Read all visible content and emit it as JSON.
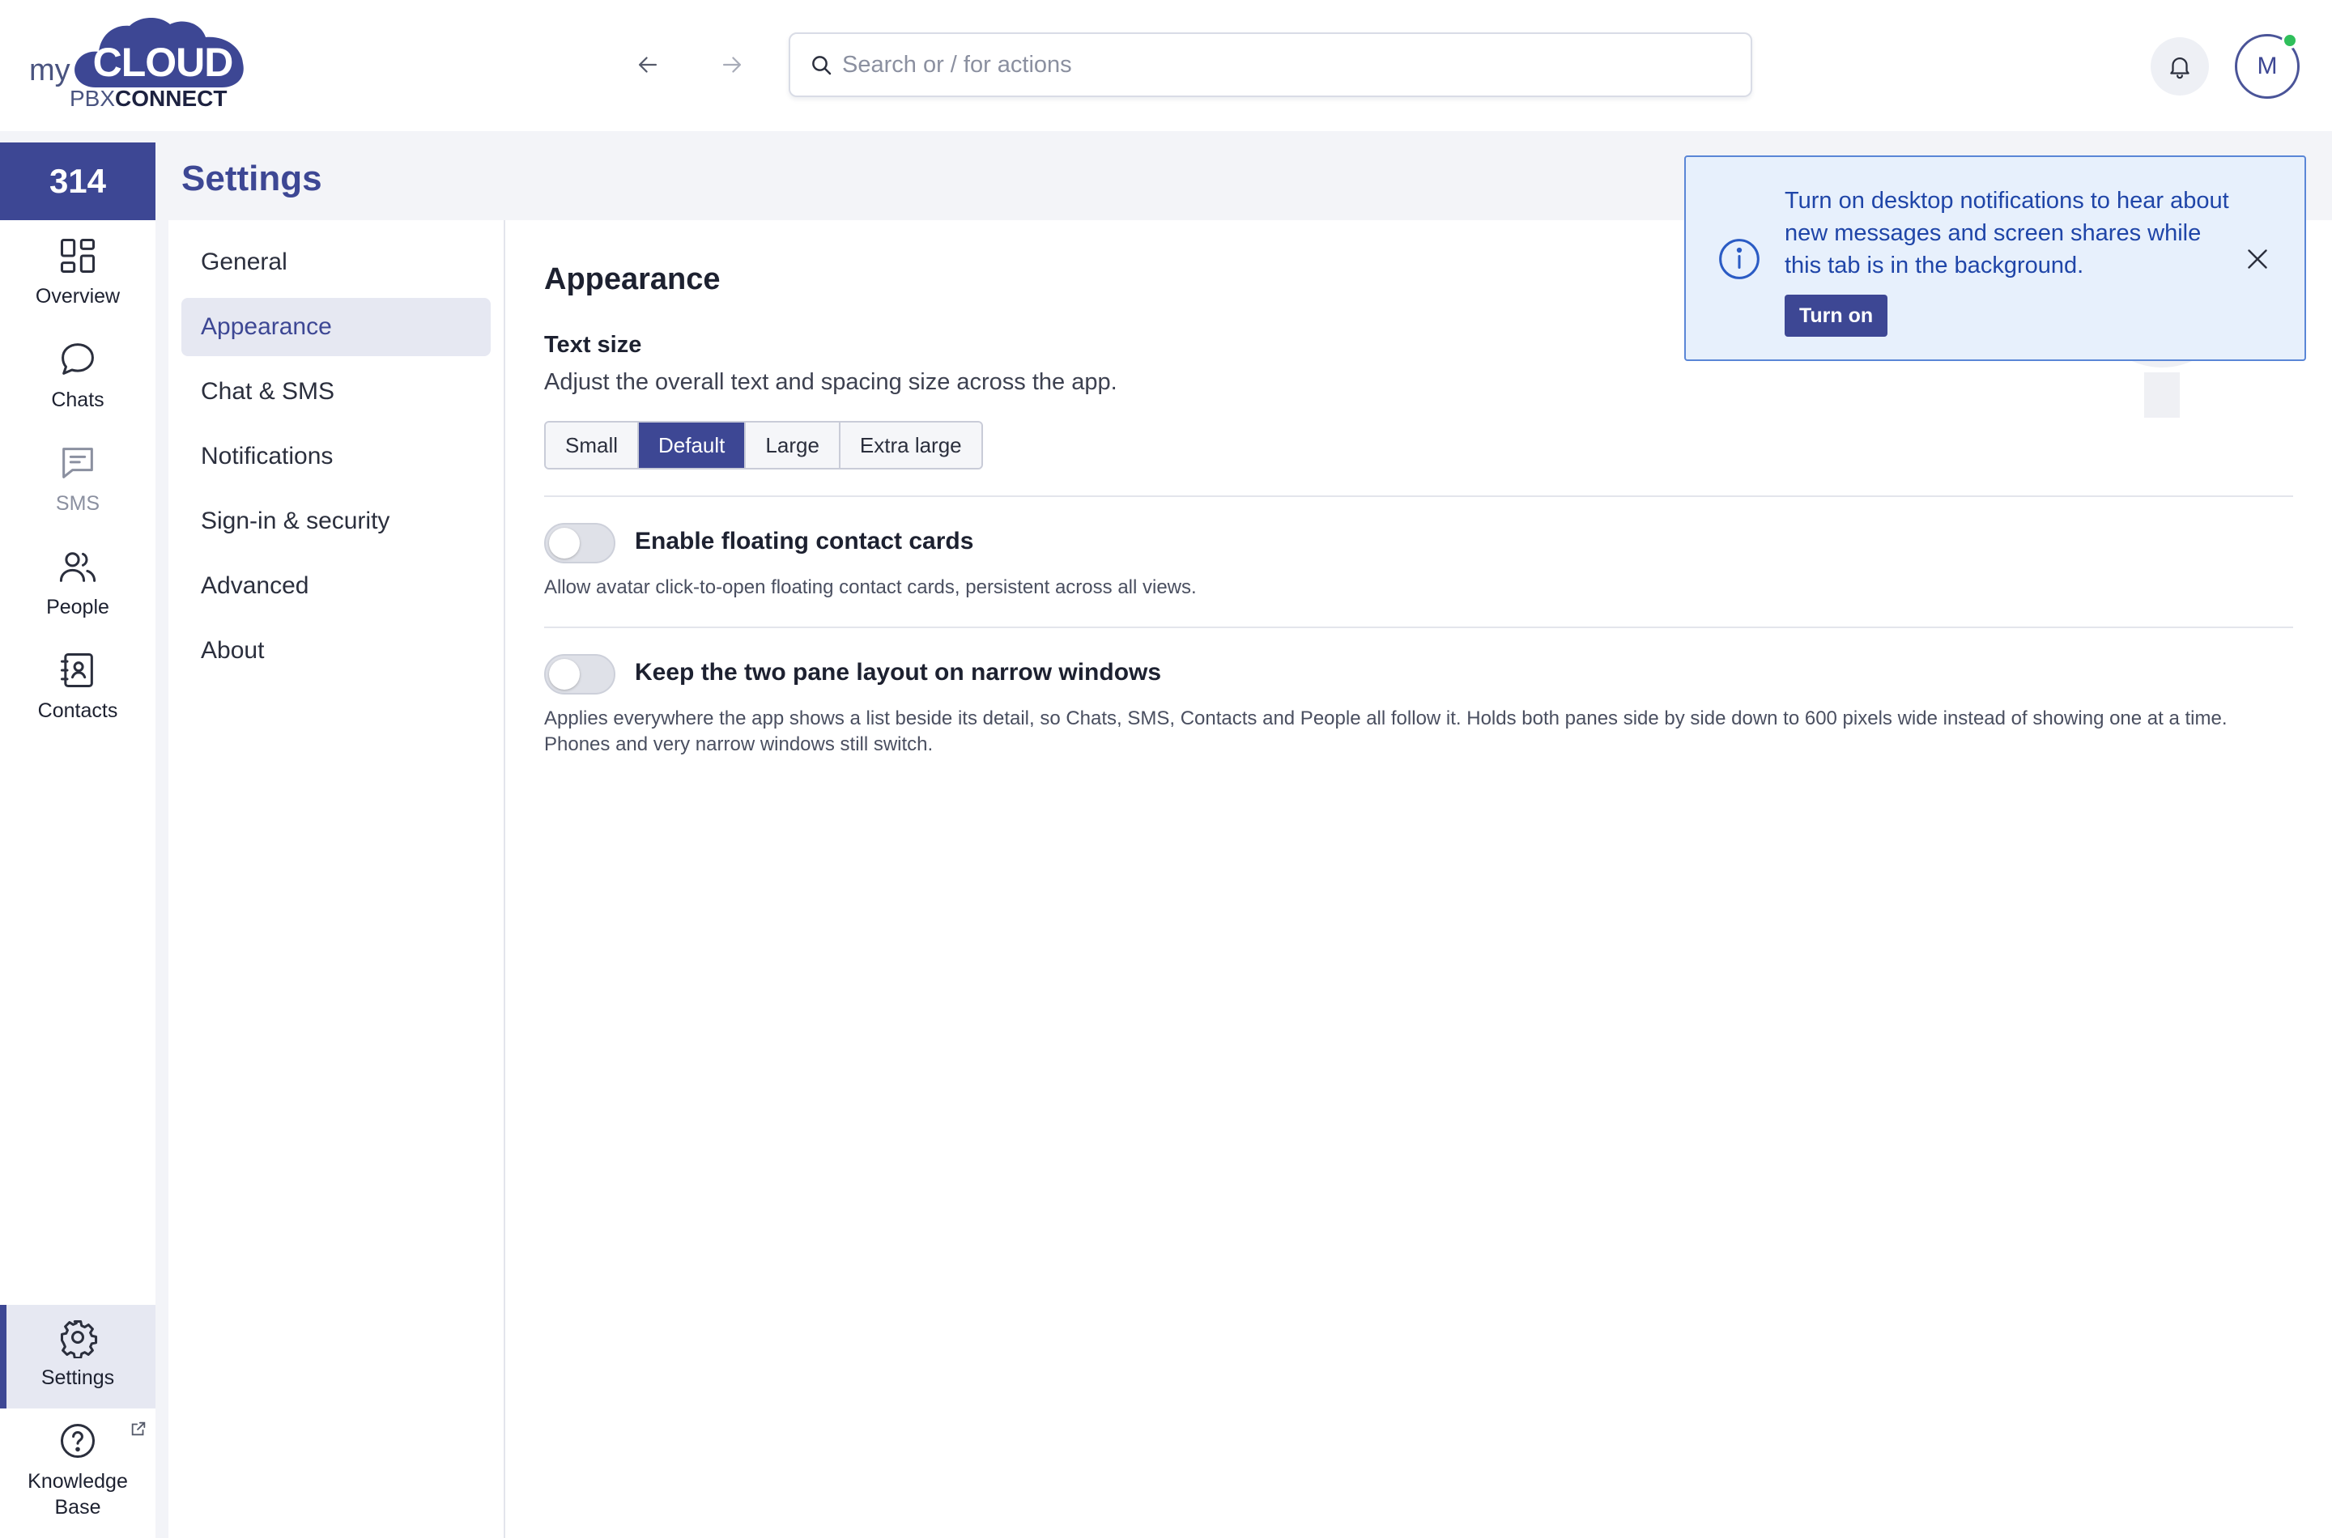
{
  "logo": {
    "my": "my",
    "cloud": "CLOUD",
    "pbx": "PBX",
    "connect": "CONNECT"
  },
  "topbar": {
    "back_icon": "arrow-left-icon",
    "forward_icon": "arrow-right-icon",
    "search_placeholder": "Search or / for actions",
    "search_value": "",
    "bell_icon": "bell-icon",
    "avatar_initial": "M",
    "presence_color": "#2fbf5b"
  },
  "rail": {
    "extension": "314",
    "items": [
      {
        "label": "Overview",
        "icon": "grid-icon"
      },
      {
        "label": "Chats",
        "icon": "chat-bubble-icon"
      },
      {
        "label": "SMS",
        "icon": "sms-icon"
      },
      {
        "label": "People",
        "icon": "people-icon"
      },
      {
        "label": "Contacts",
        "icon": "contacts-book-icon"
      }
    ],
    "settings": {
      "label": "Settings",
      "icon": "gear-icon"
    },
    "kb": {
      "label_line1": "Knowledge",
      "label_line2": "Base",
      "icon": "help-circle-icon",
      "ext_icon": "external-link-icon"
    }
  },
  "settings": {
    "title": "Settings",
    "nav": [
      {
        "label": "General"
      },
      {
        "label": "Appearance"
      },
      {
        "label": "Chat & SMS"
      },
      {
        "label": "Notifications"
      },
      {
        "label": "Sign-in & security"
      },
      {
        "label": "Advanced"
      },
      {
        "label": "About"
      }
    ],
    "active_nav": "Appearance"
  },
  "appearance": {
    "title": "Appearance",
    "text_size": {
      "label": "Text size",
      "description": "Adjust the overall text and spacing size across the app.",
      "options": [
        "Small",
        "Default",
        "Large",
        "Extra large"
      ],
      "selected": "Default"
    },
    "floating_cards": {
      "label": "Enable floating contact cards",
      "description": "Allow avatar click-to-open floating contact cards, persistent across all views.",
      "enabled": false
    },
    "two_pane": {
      "label": "Keep the two pane layout on narrow windows",
      "description": "Applies everywhere the app shows a list beside its detail, so Chats, SMS, Contacts and People all follow it. Holds both panes side by side down to 600 pixels wide instead of showing one at a time. Phones and very narrow windows still switch.",
      "enabled": false
    }
  },
  "notice": {
    "icon": "info-circle-icon",
    "text": "Turn on desktop notifications to hear about new messages and screen shares while this tab is in the background.",
    "button": "Turn on",
    "close_icon": "close-icon"
  },
  "colors": {
    "accent": "#3d4794",
    "notice_bg": "#e7f0fc",
    "notice_text": "#1f45a8"
  }
}
